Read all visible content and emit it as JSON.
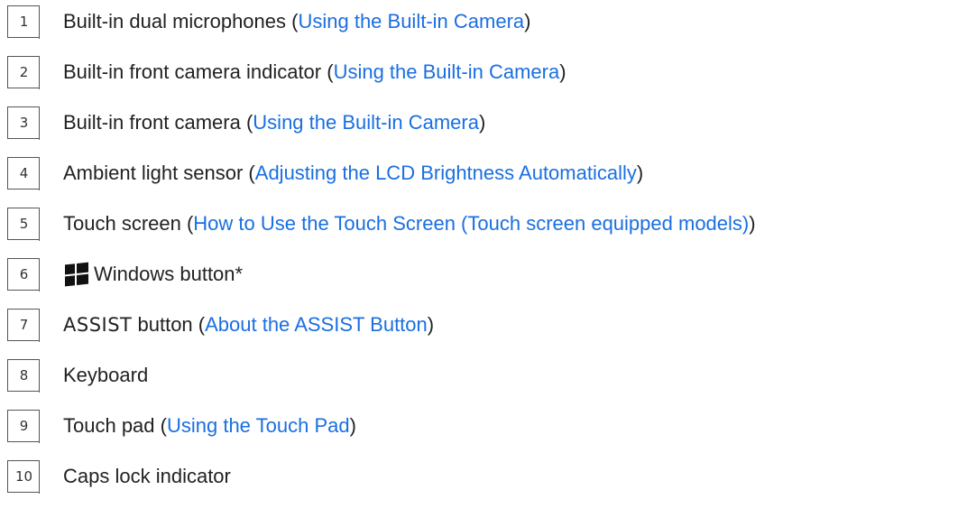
{
  "items": [
    {
      "num": "1",
      "text": "Built-in dual microphones (",
      "link": "Using the Built-in Camera",
      "after": ")"
    },
    {
      "num": "2",
      "text": "Built-in front camera indicator (",
      "link": "Using the Built-in Camera",
      "after": ")"
    },
    {
      "num": "3",
      "text": "Built-in front camera (",
      "link": "Using the Built-in Camera",
      "after": ")"
    },
    {
      "num": "4",
      "text": "Ambient light sensor (",
      "link": "Adjusting the LCD Brightness Automatically",
      "after": ")"
    },
    {
      "num": "5",
      "text": "Touch screen (",
      "link": "How to Use the Touch Screen (Touch screen equipped models)",
      "after": ")"
    },
    {
      "num": "6",
      "icon": "windows-logo-icon",
      "text": "Windows button*"
    },
    {
      "num": "7",
      "prefix": "ASSIST",
      "text": " button (",
      "link": "About the ASSIST Button",
      "after": ")"
    },
    {
      "num": "8",
      "text": "Keyboard"
    },
    {
      "num": "9",
      "text": "Touch pad (",
      "link": "Using the Touch Pad",
      "after": ")"
    },
    {
      "num": "10",
      "text": "Caps lock indicator"
    }
  ],
  "colors": {
    "link": "#1a6fe0",
    "text": "#222222",
    "border": "#555555"
  }
}
